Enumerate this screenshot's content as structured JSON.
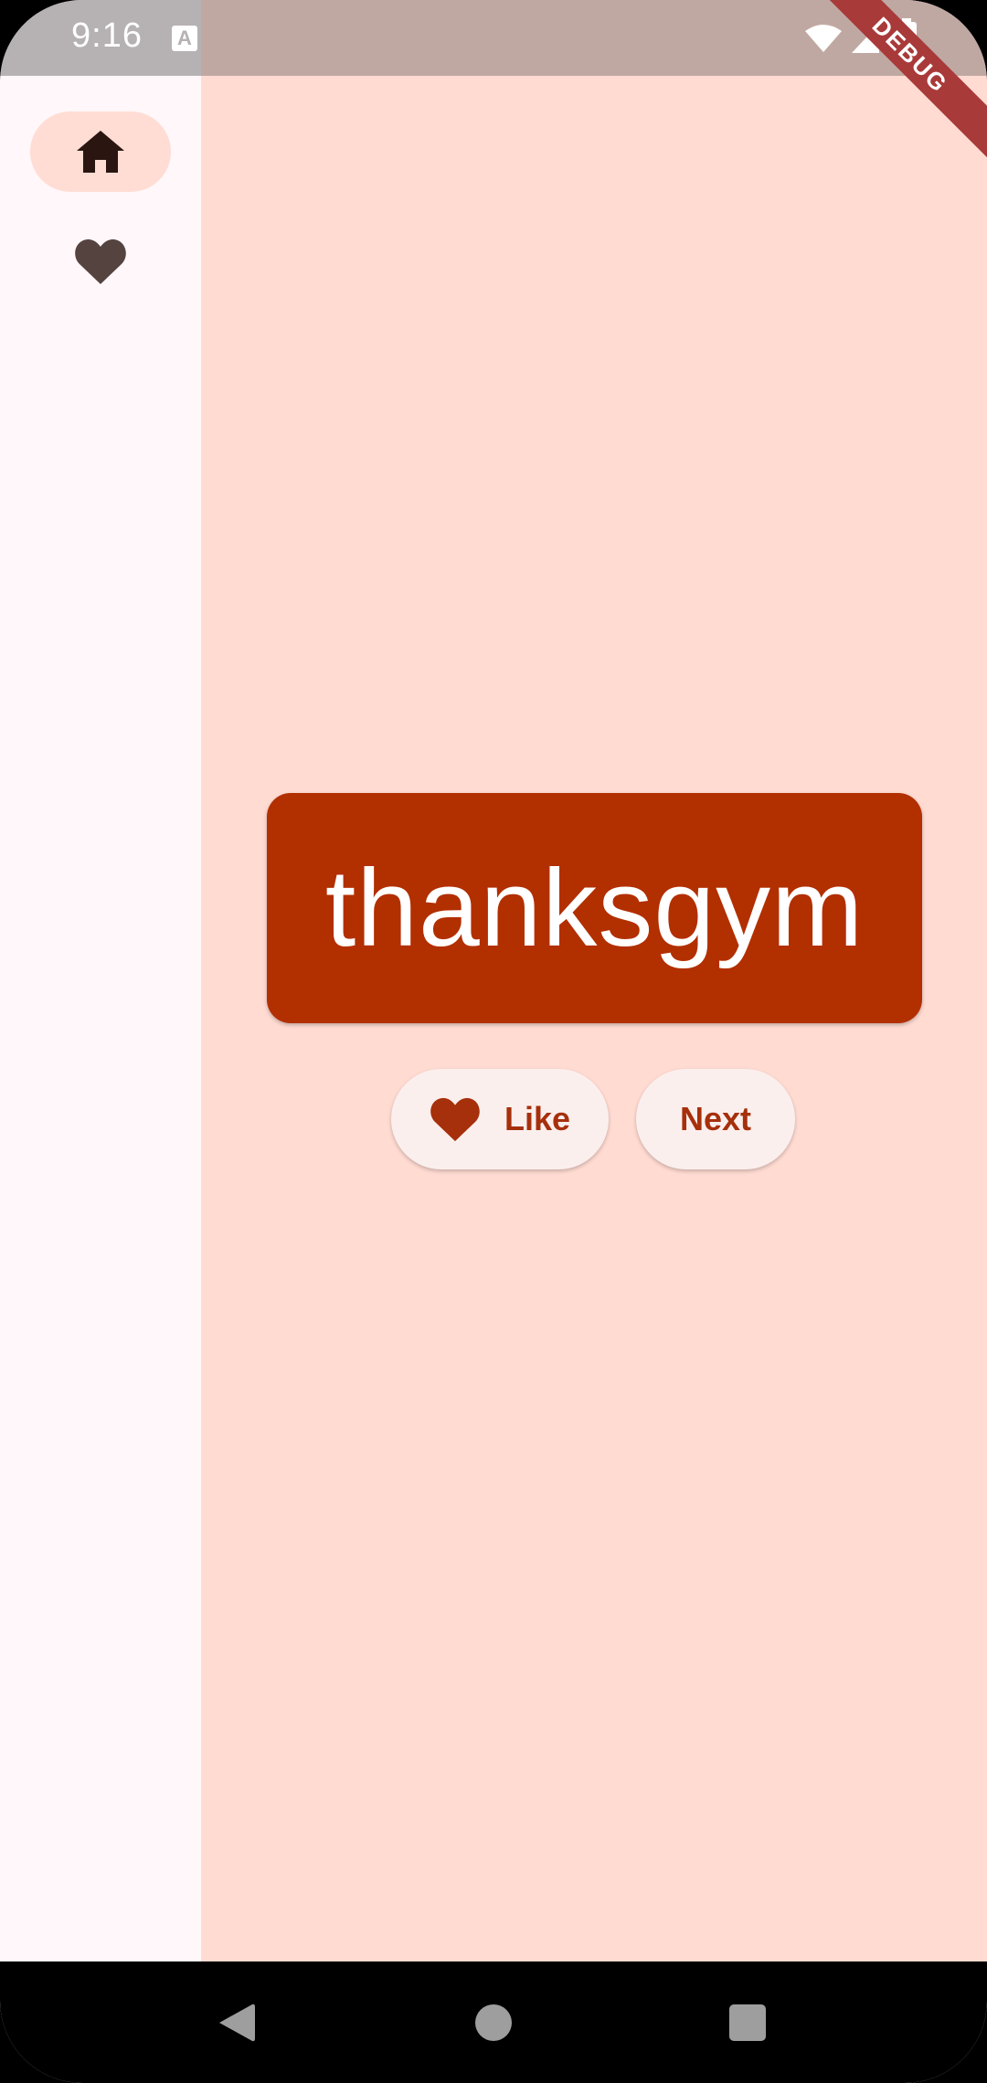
{
  "status_bar": {
    "time": "9:16",
    "notification_icon": "a-icon",
    "icons": [
      "wifi-icon",
      "signal-icon",
      "battery-icon"
    ],
    "debug_banner": "DEBUG"
  },
  "rail": {
    "items": [
      {
        "icon": "home-icon",
        "selected": true
      },
      {
        "icon": "heart-icon",
        "selected": false
      }
    ]
  },
  "main": {
    "word": "thanksgym",
    "like_label": "Like",
    "next_label": "Next"
  },
  "nav_bar": {
    "buttons": [
      "back-icon",
      "home-circle-icon",
      "recents-square-icon"
    ]
  },
  "colors": {
    "card": "#b22f00",
    "main_background": "#ffdbd2",
    "rail_background": "#fff7f9",
    "selected_indicator": "#ffddd4",
    "button_text": "#a6300b"
  }
}
